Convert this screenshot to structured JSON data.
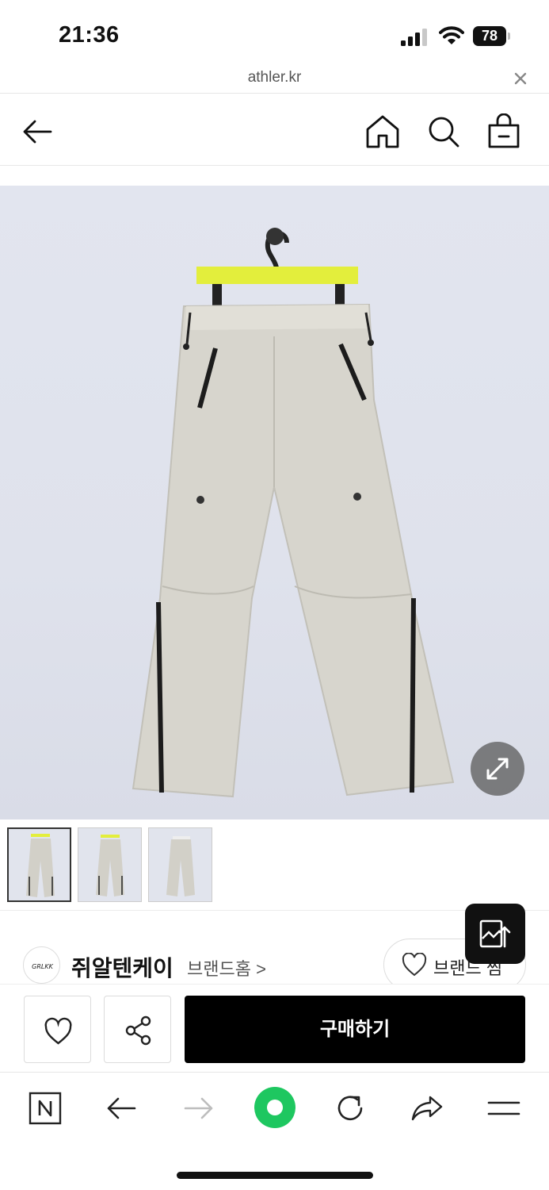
{
  "status_bar": {
    "time": "21:36",
    "battery": "78"
  },
  "url_bar": {
    "domain": "athler.kr"
  },
  "header": {
    "icons": [
      "back-arrow-icon",
      "home-icon",
      "search-icon",
      "shopping-bag-icon"
    ]
  },
  "product": {
    "expand_icon": "expand-icon",
    "thumbnail_count": 3,
    "active_thumbnail": 1
  },
  "brand": {
    "logo_text": "GRLKK",
    "name": "쥐알텐케이",
    "home_link": "브랜드홈 >",
    "fav_label": "브랜드 찜"
  },
  "actions": {
    "buy_label": "구매하기"
  },
  "browser_toolbar": {
    "icons": [
      "naver-n-icon",
      "back-icon",
      "forward-icon",
      "green-dot-icon",
      "reload-icon",
      "share-icon",
      "menu-icon"
    ]
  },
  "colors": {
    "buy_button": "#000000",
    "green_button": "#1ec760",
    "hanger_bar": "#e3ee3c",
    "pants": "#d7d5cd"
  }
}
